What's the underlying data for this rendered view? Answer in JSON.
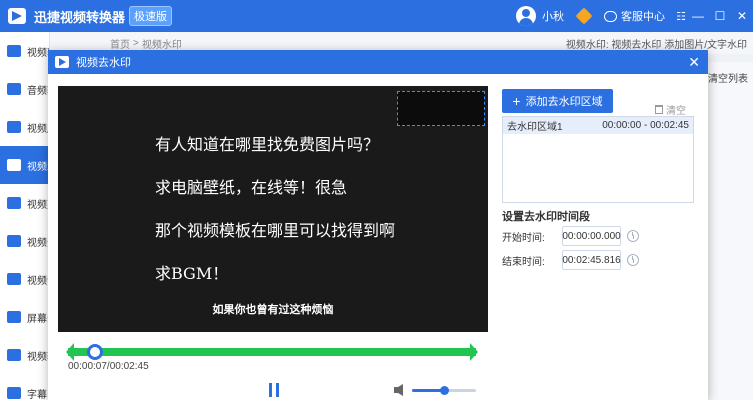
{
  "app": {
    "name": "迅捷视频转换器",
    "badge": "极速版",
    "user": "小秋",
    "service": "客服中心",
    "menu_glyph": "☷",
    "min_glyph": "—",
    "max_glyph": "☐",
    "close_glyph": "✕"
  },
  "sidebar": {
    "items": [
      {
        "label": "视频转换",
        "icon": "video-convert-icon"
      },
      {
        "label": "音频转换",
        "icon": "audio-icon"
      },
      {
        "label": "视频压缩",
        "icon": "compress-icon"
      },
      {
        "label": "视频水印",
        "icon": "watermark-icon",
        "active": true
      },
      {
        "label": "视频剪辑",
        "icon": "edit-icon"
      },
      {
        "label": "视频分割",
        "icon": "split-icon"
      },
      {
        "label": "视频合并",
        "icon": "merge-icon"
      },
      {
        "label": "屏幕录像",
        "icon": "screen-record-icon"
      },
      {
        "label": "视频转GIF",
        "icon": "gif-icon"
      },
      {
        "label": "字幕",
        "icon": "subtitle-icon"
      }
    ]
  },
  "main": {
    "crumb_home": "首页",
    "crumb_sep": ">",
    "crumb_current": "视频水印",
    "hint": "视频水印: 视频去水印 添加图片/文字水印",
    "right_label": "清空列表"
  },
  "modal": {
    "title": "视频去水印",
    "close_glyph": "✕",
    "video": {
      "lines": [
        "有人知道在哪里找免费图片吗？",
        "求电脑壁纸，在线等！很急",
        "那个视频模板在哪里可以找得到啊",
        "求BGM！"
      ],
      "caption": "如果你也曾有过这种烦恼"
    },
    "timeline": {
      "position_fraction": 0.067,
      "time_readout": "00:00:07/00:02:45"
    },
    "volume_fraction": 0.5,
    "add_button": "添加去水印区域",
    "add_plus": "+",
    "clear_button": "清空",
    "regions": [
      {
        "name": "去水印区域1",
        "range": "00:00:00 - 00:02:45"
      }
    ],
    "time_section_title": "设置去水印时间段",
    "start_label": "开始时间:",
    "start_value": "00:00:00.000",
    "end_label": "结束时间:",
    "end_value": "00:02:45.816"
  }
}
